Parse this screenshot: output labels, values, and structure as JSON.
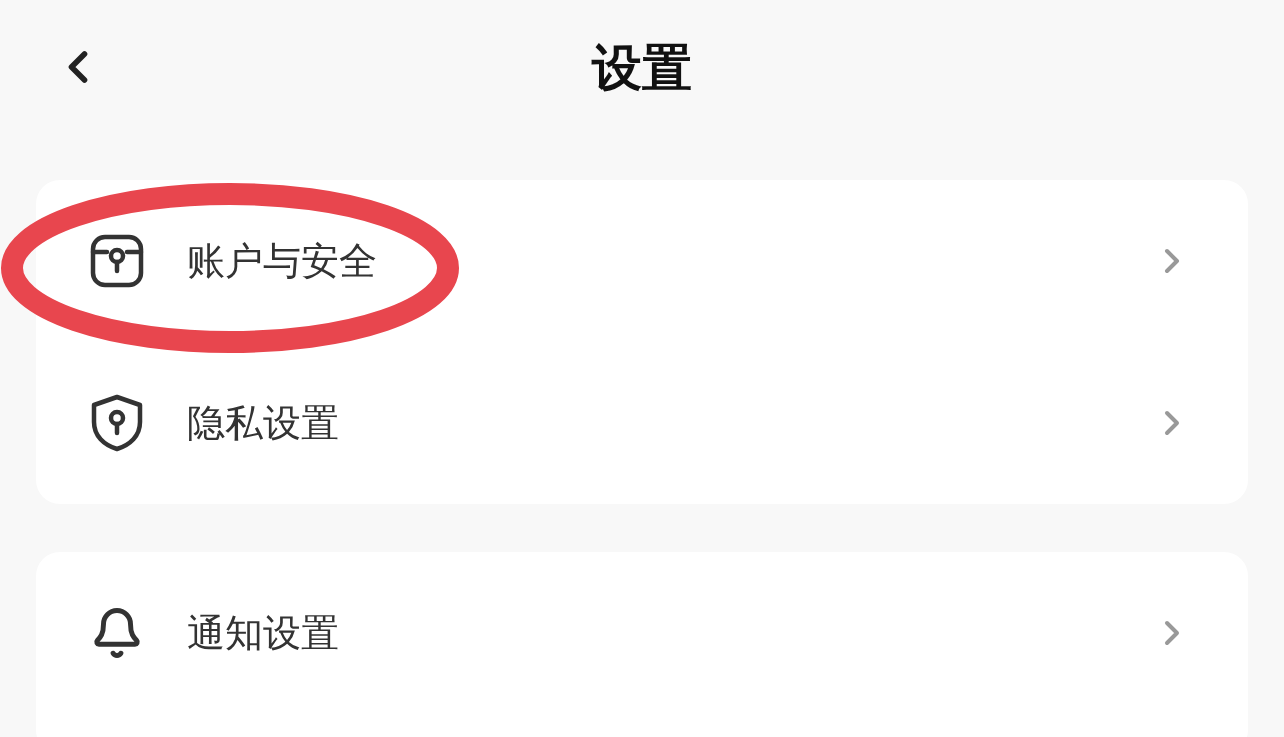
{
  "header": {
    "title": "设置"
  },
  "groups": [
    {
      "items": [
        {
          "label": "账户与安全",
          "highlighted": true
        },
        {
          "label": "隐私设置",
          "highlighted": false
        }
      ]
    },
    {
      "items": [
        {
          "label": "通知设置",
          "highlighted": false
        }
      ]
    }
  ]
}
